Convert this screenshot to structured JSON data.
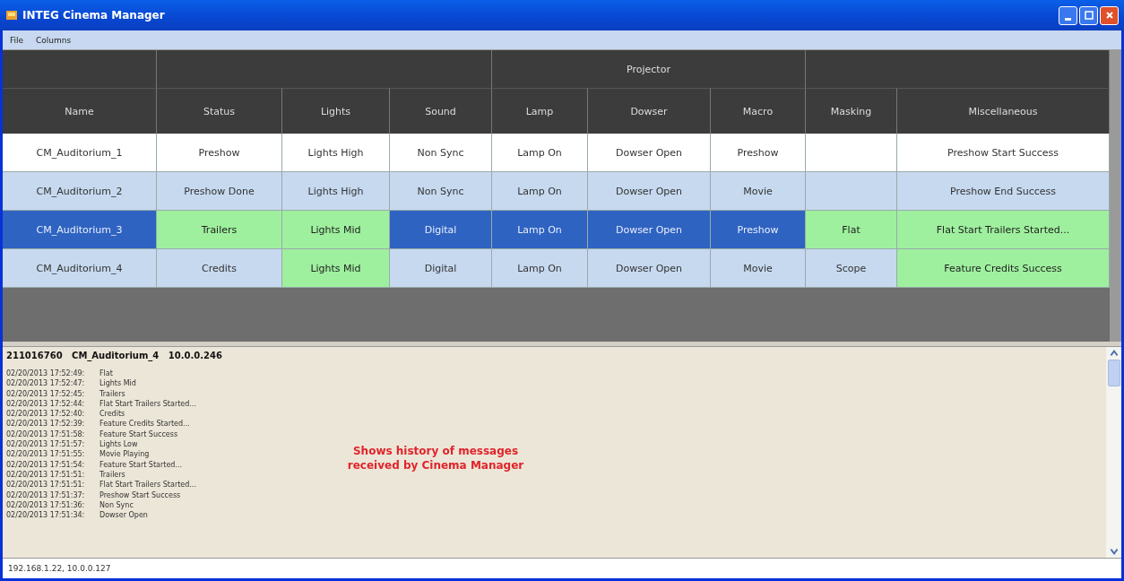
{
  "window": {
    "title": "INTEG Cinema Manager"
  },
  "menu": [
    "File",
    "Columns"
  ],
  "table": {
    "group_header": "Projector",
    "columns": [
      "Name",
      "Status",
      "Lights",
      "Sound",
      "Lamp",
      "Dowser",
      "Macro",
      "Masking",
      "Miscellaneous"
    ],
    "rows": [
      {
        "selected": false,
        "cells": [
          {
            "text": "CM_Auditorium_1",
            "highlight": false
          },
          {
            "text": "Preshow",
            "highlight": false
          },
          {
            "text": "Lights High",
            "highlight": false
          },
          {
            "text": "Non Sync",
            "highlight": false
          },
          {
            "text": "Lamp On",
            "highlight": false
          },
          {
            "text": "Dowser Open",
            "highlight": false
          },
          {
            "text": "Preshow",
            "highlight": false
          },
          {
            "highlight": false
          },
          {
            "text": "Preshow Start Success",
            "highlight": false
          }
        ]
      },
      {
        "selected": false,
        "cells": [
          {
            "text": "CM_Auditorium_2",
            "highlight": false
          },
          {
            "text": "Preshow Done",
            "highlight": false
          },
          {
            "text": "Lights High",
            "highlight": false
          },
          {
            "text": "Non Sync",
            "highlight": false
          },
          {
            "text": "Lamp On",
            "highlight": false
          },
          {
            "text": "Dowser Open",
            "highlight": false
          },
          {
            "text": "Movie",
            "highlight": false
          },
          {
            "highlight": false
          },
          {
            "text": "Preshow End Success",
            "highlight": false
          }
        ]
      },
      {
        "selected": true,
        "cells": [
          {
            "text": "CM_Auditorium_3",
            "highlight": false
          },
          {
            "text": "Trailers",
            "highlight": true
          },
          {
            "text": "Lights Mid",
            "highlight": true
          },
          {
            "text": "Digital",
            "highlight": false
          },
          {
            "text": "Lamp On",
            "highlight": false
          },
          {
            "text": "Dowser Open",
            "highlight": false
          },
          {
            "text": "Preshow",
            "highlight": false
          },
          {
            "text": "Flat",
            "highlight": true
          },
          {
            "text": "Flat Start Trailers Started...",
            "highlight": true
          }
        ]
      },
      {
        "selected": false,
        "cells": [
          {
            "text": "CM_Auditorium_4",
            "highlight": false
          },
          {
            "text": "Credits",
            "highlight": false
          },
          {
            "text": "Lights Mid",
            "highlight": true
          },
          {
            "text": "Digital",
            "highlight": false
          },
          {
            "text": "Lamp On",
            "highlight": false
          },
          {
            "text": "Dowser Open",
            "highlight": false
          },
          {
            "text": "Movie",
            "highlight": false
          },
          {
            "text": "Scope",
            "highlight": false
          },
          {
            "text": "Feature Credits Success",
            "highlight": true
          }
        ]
      }
    ]
  },
  "log": {
    "header": "211016760   CM_Auditorium_4   10.0.0.246",
    "entries": [
      {
        "time": "02/20/2013 17:52:49:",
        "message": "Flat"
      },
      {
        "time": "02/20/2013 17:52:47:",
        "message": "Lights Mid"
      },
      {
        "time": "02/20/2013 17:52:45:",
        "message": "Trailers"
      },
      {
        "time": "02/20/2013 17:52:44:",
        "message": "Flat Start Trailers Started..."
      },
      {
        "time": "02/20/2013 17:52:40:",
        "message": "Credits"
      },
      {
        "time": "02/20/2013 17:52:39:",
        "message": "Feature Credits Started..."
      },
      {
        "time": "02/20/2013 17:51:58:",
        "message": "Feature Start Success"
      },
      {
        "time": "02/20/2013 17:51:57:",
        "message": "Lights Low"
      },
      {
        "time": "02/20/2013 17:51:55:",
        "message": "Movie Playing"
      },
      {
        "time": "02/20/2013 17:51:54:",
        "message": "Feature Start Started..."
      },
      {
        "time": "02/20/2013 17:51:51:",
        "message": "Trailers"
      },
      {
        "time": "02/20/2013 17:51:51:",
        "message": "Flat Start Trailers Started..."
      },
      {
        "time": "02/20/2013 17:51:37:",
        "message": "Preshow Start Success"
      },
      {
        "time": "02/20/2013 17:51:36:",
        "message": "Non Sync"
      },
      {
        "time": "02/20/2013 17:51:34:",
        "message": "Dowser Open"
      }
    ],
    "annotation": "Shows history of messages received by Cinema Manager"
  },
  "status_bar": "192.168.1.22, 10.0.0.127"
}
